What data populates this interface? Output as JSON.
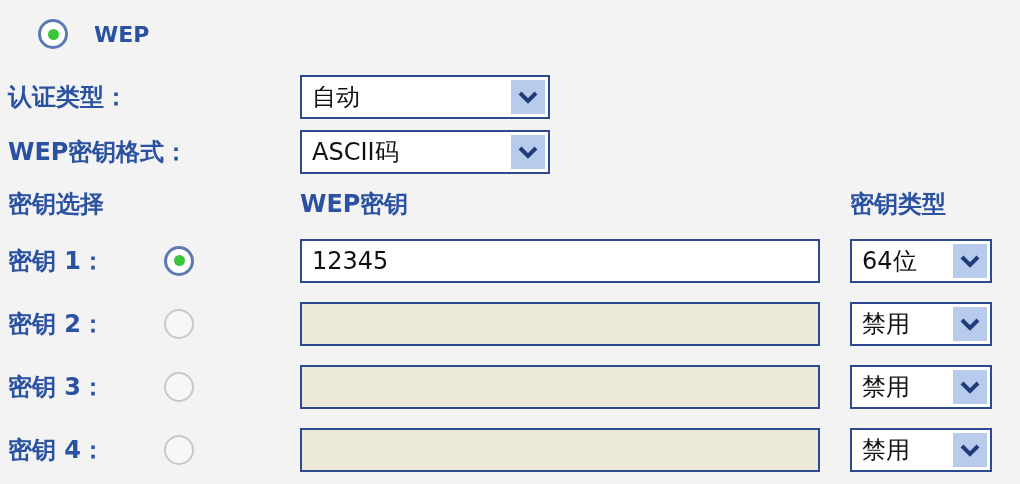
{
  "security_mode": {
    "label": "WEP",
    "selected": true
  },
  "auth_type": {
    "label": "认证类型：",
    "value": "自动"
  },
  "key_format": {
    "label": "WEP密钥格式：",
    "value": "ASCII码"
  },
  "key_table": {
    "columns": [
      "密钥选择",
      "WEP密钥",
      "密钥类型"
    ],
    "rows": [
      {
        "label": "密钥 1：",
        "selected": true,
        "value": "12345",
        "disabled": false,
        "key_type": "64位"
      },
      {
        "label": "密钥 2：",
        "selected": false,
        "disabled": true,
        "key_type": "禁用"
      },
      {
        "label": "密钥 3：",
        "selected": false,
        "disabled": true,
        "key_type": "禁用"
      },
      {
        "label": "密钥 4：",
        "selected": false,
        "disabled": true,
        "key_type": "禁用"
      }
    ]
  }
}
